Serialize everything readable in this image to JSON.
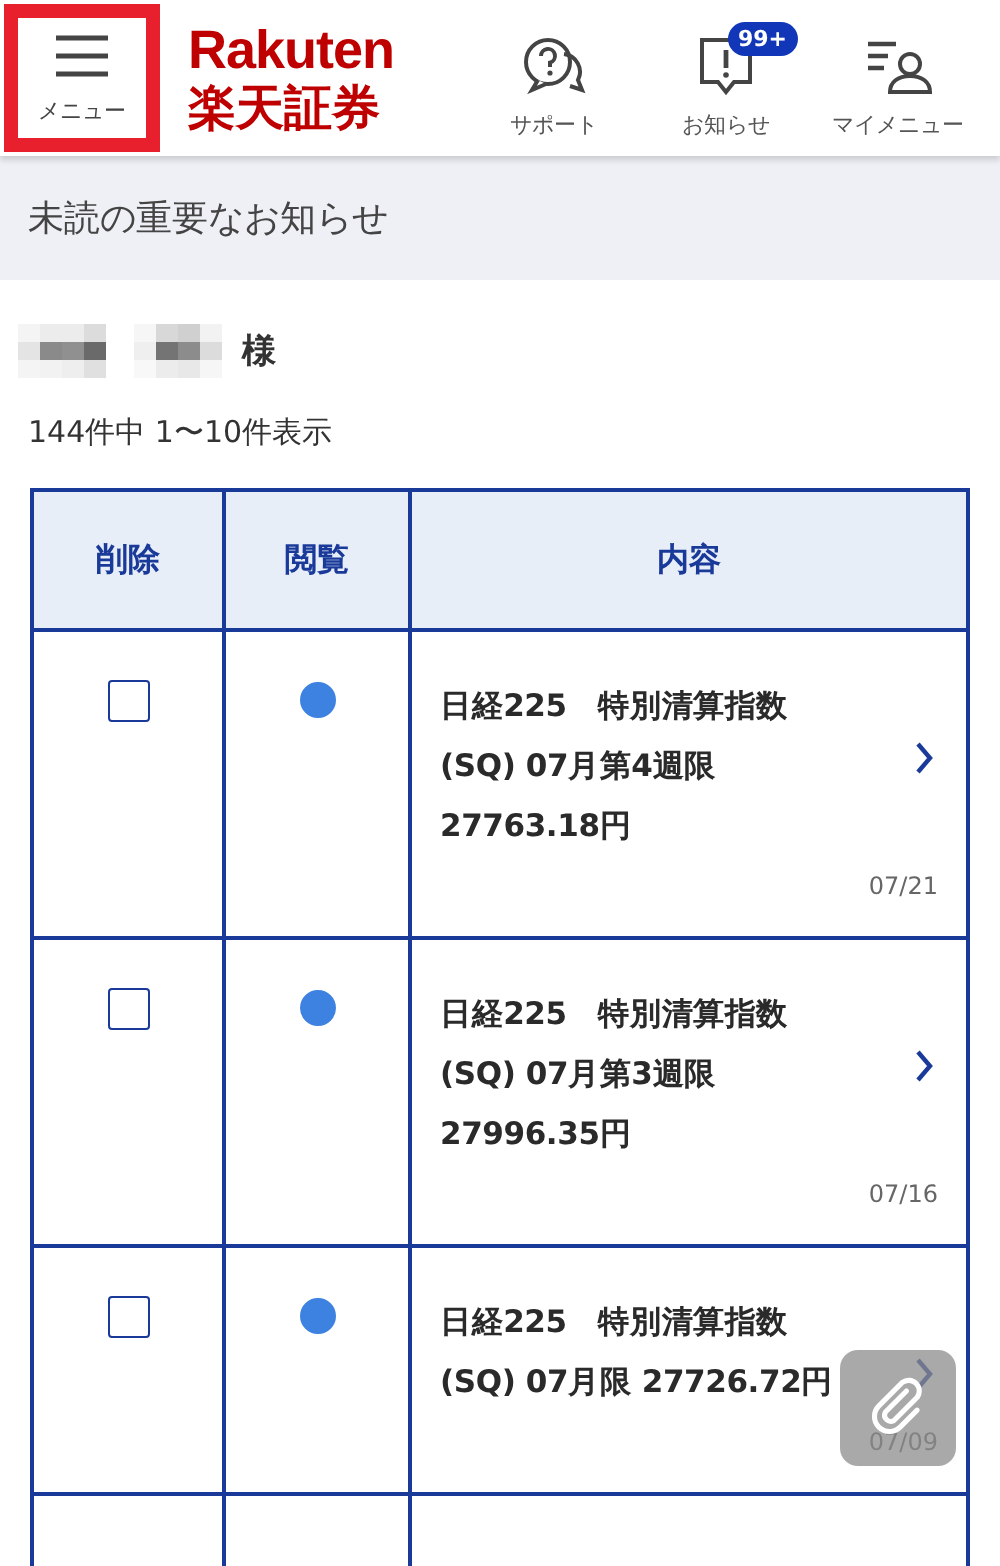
{
  "header": {
    "menu_label": "メニュー",
    "logo_top": "Rakuten",
    "logo_bottom": "楽天証券",
    "nav": [
      {
        "kind": "support",
        "label": "サポート"
      },
      {
        "kind": "notice",
        "label": "お知らせ",
        "badge": "99+"
      },
      {
        "kind": "mymenu",
        "label": "マイメニュー"
      }
    ]
  },
  "banner": "未読の重要なお知らせ",
  "user": {
    "suffix": "様"
  },
  "count": "144件中  1〜10件表示",
  "table": {
    "columns": [
      "削除",
      "閲覧",
      "内容"
    ],
    "rows": [
      {
        "checked": false,
        "unread": true,
        "lines": [
          "日経225　特別清算指数",
          "(SQ) 07月第4週限",
          "27763.18円"
        ],
        "date": "07/21"
      },
      {
        "checked": false,
        "unread": true,
        "lines": [
          "日経225　特別清算指数",
          "(SQ) 07月第3週限",
          "27996.35円"
        ],
        "date": "07/16"
      },
      {
        "checked": false,
        "unread": true,
        "lines": [
          "日経225　特別清算指数",
          "(SQ) 07月限 27726.72円"
        ],
        "date": "07/09"
      }
    ]
  }
}
